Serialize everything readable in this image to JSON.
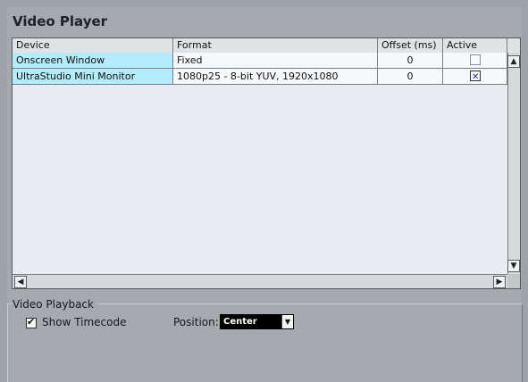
{
  "panel": {
    "title": "Video Player"
  },
  "table": {
    "columns": [
      "Device",
      "Format",
      "Offset (ms)",
      "Active"
    ],
    "rows": [
      {
        "device": "Onscreen Window",
        "format": "Fixed",
        "offset": "0",
        "active": false
      },
      {
        "device": "UltraStudio Mini Monitor",
        "format": "1080p25 - 8-bit YUV, 1920x1080",
        "offset": "0",
        "active": true
      }
    ]
  },
  "playback": {
    "group_label": "Video Playback",
    "show_timecode_label": "Show Timecode",
    "show_timecode_checked": true,
    "position_label": "Position:",
    "position_value": "Center"
  },
  "icons": {
    "scroll_up": "chevron-up-icon",
    "scroll_down": "chevron-down-icon",
    "scroll_left": "chevron-left-icon",
    "scroll_right": "chevron-right-icon",
    "dropdown": "chevron-down-icon"
  },
  "colors": {
    "device_cell": "#b3ecfa",
    "check_mark": "#1a2fa0"
  }
}
